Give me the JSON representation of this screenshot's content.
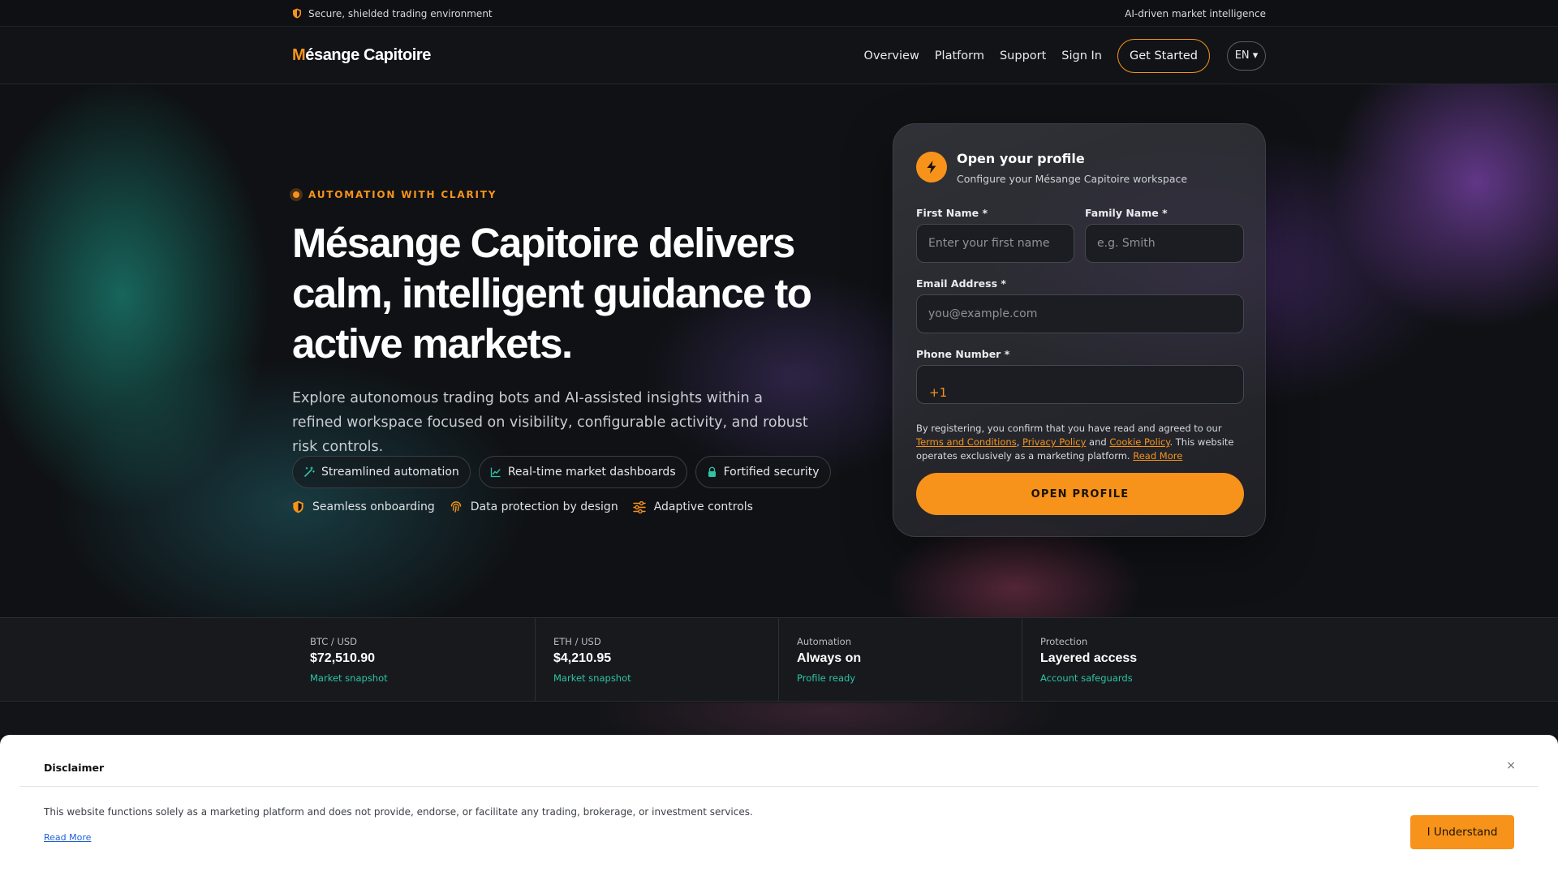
{
  "topbar": {
    "security_text": "Secure, shielded trading environment",
    "right_text": "AI-driven market intelligence"
  },
  "header": {
    "logo_initial": "M",
    "logo_rest": "ésange Capitoire",
    "nav": [
      "Overview",
      "Platform",
      "Support",
      "Sign In"
    ],
    "cta_label": "Get Started",
    "lang_label": "EN ▾"
  },
  "hero": {
    "eyebrow": "AUTOMATION WITH CLARITY",
    "headline": "Mésange Capitoire delivers calm, intelligent guidance to active markets.",
    "lead": "Explore autonomous trading bots and AI-assisted insights within a refined workspace focused on visibility, configurable activity, and robust risk controls.",
    "chips": [
      {
        "label": "Streamlined automation",
        "icon": "magic-wand-icon"
      },
      {
        "label": "Real-time market dashboards",
        "icon": "line-chart-icon"
      },
      {
        "label": "Fortified security",
        "icon": "lock-icon"
      }
    ],
    "features": [
      {
        "label": "Seamless onboarding",
        "icon": "shield-icon"
      },
      {
        "label": "Data protection by design",
        "icon": "fingerprint-icon"
      },
      {
        "label": "Adaptive controls",
        "icon": "sliders-icon"
      }
    ]
  },
  "form": {
    "title": "Open your profile",
    "subtitle": "Configure your Mésange Capitoire workspace",
    "first_name_label": "First Name *",
    "first_name_placeholder": "Enter your first name",
    "family_name_label": "Family Name *",
    "family_name_placeholder": "e.g. Smith",
    "email_label": "Email Address *",
    "email_placeholder": "you@example.com",
    "phone_label": "Phone Number *",
    "phone_prefix": "+1",
    "legal_intro": "By registering, you confirm that you have read and agreed to our ",
    "terms_link": "Terms and Conditions",
    "comma": ", ",
    "privacy_link": "Privacy Policy",
    "and_text": " and ",
    "cookie_link": "Cookie Policy",
    "legal_tail": ". This website operates exclu­sively as a marketing platform. ",
    "read_more": "Read More",
    "submit_label": "OPEN PROFILE"
  },
  "stats": [
    {
      "label": "BTC / USD",
      "value": "$72,510.90",
      "sub": "Market snapshot"
    },
    {
      "label": "ETH / USD",
      "value": "$4,210.95",
      "sub": "Market snapshot"
    },
    {
      "label": "Automation",
      "value": "Always on",
      "sub": "Profile ready"
    },
    {
      "label": "Protection",
      "value": "Layered access",
      "sub": "Account safeguards"
    }
  ],
  "disclaimer": {
    "title": "Disclaimer",
    "text": "This website functions solely as a marketing platform and does not provide, endorse, or facilitate any trading, brokerage, or investment services.",
    "read_more": "Read More",
    "button_label": "I Understand",
    "close_label": "×"
  },
  "colors": {
    "accent": "#f7931a",
    "teal": "#2ec4a6",
    "background": "#0f1114"
  }
}
